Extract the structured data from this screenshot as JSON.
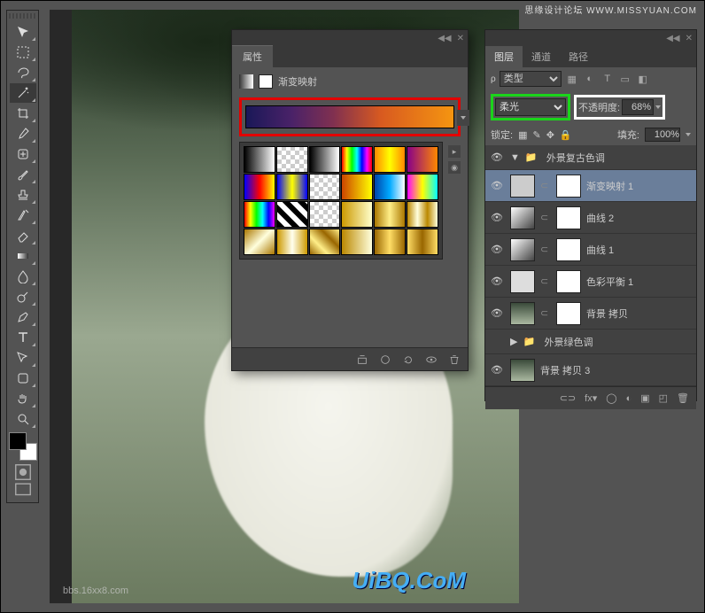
{
  "watermarks": {
    "top": "思缘设计论坛 WWW.MISSYUAN.COM",
    "bottom_left": "bbs.16xx8.com",
    "bottom_right": "UiBQ.CoM"
  },
  "props_panel": {
    "tab": "属性",
    "title": "渐变映射",
    "bottom_icons": [
      "clip",
      "reset",
      "prev",
      "eye",
      "trash"
    ]
  },
  "layers_panel": {
    "tabs": [
      "图层",
      "通道",
      "路径"
    ],
    "kind_label": "类型",
    "blend_mode": "柔光",
    "opacity_label": "不透明度:",
    "opacity_value": "68%",
    "lock_label": "锁定:",
    "fill_label": "填充:",
    "fill_value": "100%",
    "items": [
      {
        "type": "group",
        "name": "外景复古色调",
        "open": true,
        "vis": true
      },
      {
        "type": "adj",
        "name": "渐变映射 1",
        "selected": true,
        "vis": true,
        "mask": true
      },
      {
        "type": "adj",
        "name": "曲线 2",
        "vis": true,
        "mask": true,
        "icon": "curves"
      },
      {
        "type": "adj",
        "name": "曲线 1",
        "vis": true,
        "mask": true,
        "icon": "curves"
      },
      {
        "type": "adj",
        "name": "色彩平衡 1",
        "vis": true,
        "mask": true,
        "icon": "balance"
      },
      {
        "type": "layer",
        "name": "背景 拷贝",
        "vis": true,
        "mask": true
      },
      {
        "type": "group",
        "name": "外景绿色调",
        "open": false,
        "vis": false
      },
      {
        "type": "layer",
        "name": "背景 拷贝 3",
        "vis": true
      }
    ],
    "bottom_icons": [
      "link",
      "fx",
      "mask",
      "adj",
      "group",
      "new",
      "trash"
    ]
  },
  "tools": [
    "move",
    "marquee",
    "lasso",
    "wand",
    "crop",
    "eyedrop",
    "heal",
    "brush",
    "stamp",
    "history",
    "eraser",
    "gradient",
    "blur",
    "dodge",
    "pen",
    "type",
    "path",
    "shape",
    "hand",
    "zoom"
  ],
  "swatch_gradients": [
    "linear-gradient(90deg,#000,#fff)",
    "repeating-conic-gradient(#ccc 0 25%,#fff 0 50%) 0/10px 10px",
    "linear-gradient(90deg,#000,#fff)",
    "linear-gradient(90deg,#f00,#ff0,#0f0,#0ff,#00f,#f0f,#f00)",
    "linear-gradient(90deg,#f80,#ff0,#f80)",
    "linear-gradient(90deg,#808,#f80)",
    "linear-gradient(90deg,#00f,#f00,#ff0)",
    "linear-gradient(90deg,#00f,#ff0,#00f)",
    "repeating-conic-gradient(#ccc 0 25%,#fff 0 50%) 0/10px 10px",
    "linear-gradient(90deg,#c40,#ff0)",
    "linear-gradient(90deg,#04a,#0af,#fff)",
    "linear-gradient(90deg,#f0f,#ff0,#0ff)",
    "linear-gradient(90deg,#f00,#ff0,#0f0,#0ff,#00f,#f0f)",
    "repeating-linear-gradient(45deg,#000 0 6px,#fff 6px 12px)",
    "repeating-conic-gradient(#ccc 0 25%,#fff 0 50%) 0/10px 10px",
    "linear-gradient(90deg,#c90,#ffc)",
    "linear-gradient(90deg,#a70,#fe8,#a70)",
    "linear-gradient(90deg,#b80,#ffd,#b80,#ffd)",
    "linear-gradient(135deg,#a70,#ffd,#a70)",
    "linear-gradient(90deg,#c90,#ffe,#c90)",
    "linear-gradient(45deg,#960,#fe8,#960,#fe8)",
    "linear-gradient(90deg,#b80,#ffd)",
    "linear-gradient(90deg,#960,#fd6,#960)",
    "linear-gradient(90deg,#fd6,#960,#fd6)"
  ]
}
